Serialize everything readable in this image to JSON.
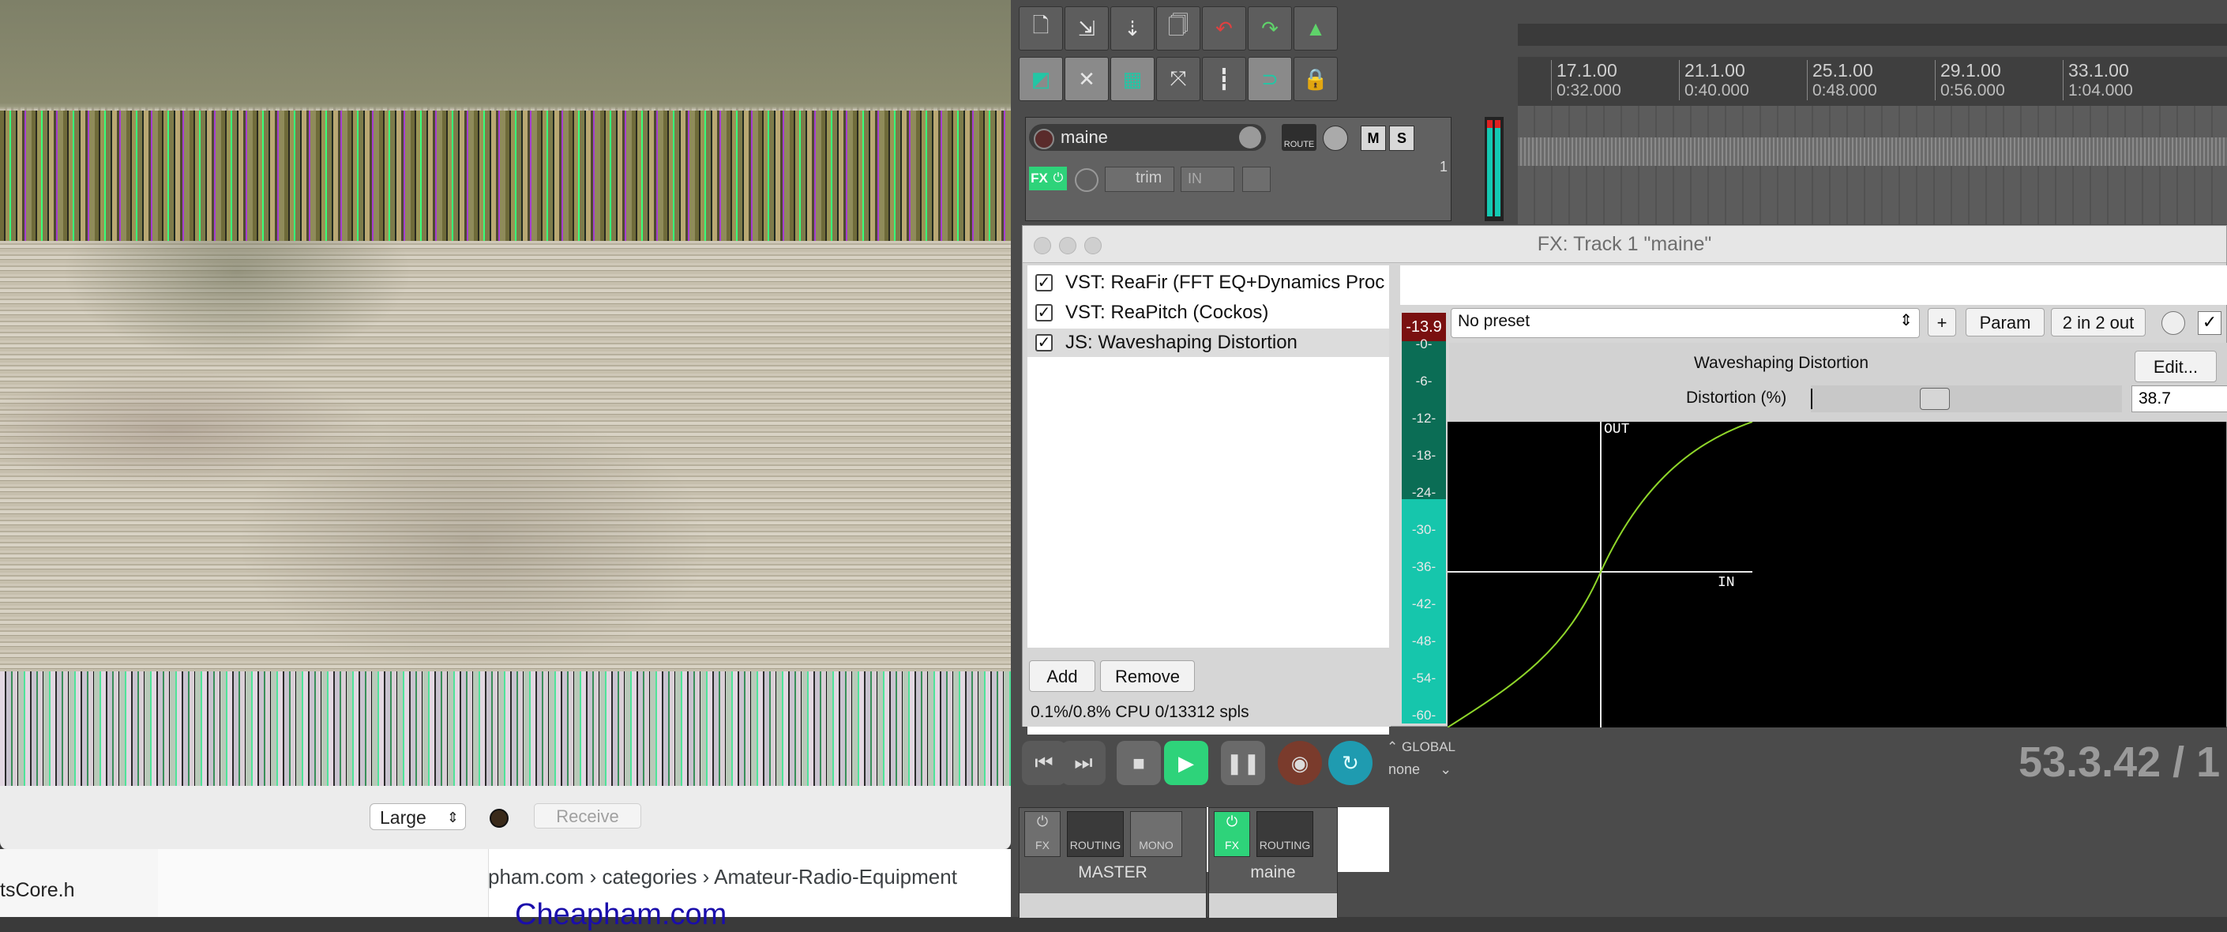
{
  "video_window": {
    "size_select": "Large",
    "receive_label": "Receive"
  },
  "browser": {
    "sidebar_text": "tsCore.h",
    "breadcrumb": "pham.com › categories › Amateur-Radio-Equipment",
    "site_link": "Cheapham.com"
  },
  "ruler": [
    {
      "bar": "17.1.00",
      "time": "0:32.000"
    },
    {
      "bar": "21.1.00",
      "time": "0:40.000"
    },
    {
      "bar": "25.1.00",
      "time": "0:48.000"
    },
    {
      "bar": "29.1.00",
      "time": "0:56.000"
    },
    {
      "bar": "33.1.00",
      "time": "1:04.000"
    }
  ],
  "track": {
    "name": "maine",
    "route_label": "ROUTE",
    "mute": "M",
    "solo": "S",
    "fx": "FX",
    "trim": "trim",
    "in_label": "IN",
    "number": "1"
  },
  "fx_window": {
    "title": "FX: Track 1 \"maine\"",
    "items": [
      {
        "label": "VST: ReaFir (FFT EQ+Dynamics Proc",
        "checked": true
      },
      {
        "label": "VST: ReaPitch (Cockos)",
        "checked": true
      },
      {
        "label": "JS: Waveshaping Distortion",
        "checked": true
      }
    ],
    "add_label": "Add",
    "remove_label": "Remove",
    "cpu_text": "0.1%/0.8% CPU 0/13312 spls",
    "preset": "No preset",
    "plus_label": "+",
    "param_label": "Param",
    "io_label": "2 in 2 out",
    "plugin_title": "Waveshaping Distortion",
    "edit_label": "Edit...",
    "slider_label": "Distortion (%)",
    "slider_value": "38.7",
    "slider_fraction": 0.387,
    "meter_peak": "-13.9",
    "meter_scale": [
      "-0-",
      "-6-",
      "-12-",
      "-18-",
      "-24-",
      "-30-",
      "-36-",
      "-42-",
      "-48-",
      "-54-",
      "-60-"
    ],
    "graph_out": "OUT",
    "graph_in": "IN"
  },
  "transport": {
    "global_label": "GLOBAL",
    "global_mode": "none",
    "position": "53.3.42 / 1"
  },
  "mixer": {
    "master": {
      "name": "MASTER",
      "fx": "FX",
      "routing": "ROUTING",
      "mono": "MONO"
    },
    "track": {
      "name": "maine",
      "fx": "FX",
      "routing": "ROUTING"
    }
  },
  "colors": {
    "accent_green": "#2ed37a",
    "meter_teal": "#14c9b3",
    "curve": "#8fd62a"
  }
}
